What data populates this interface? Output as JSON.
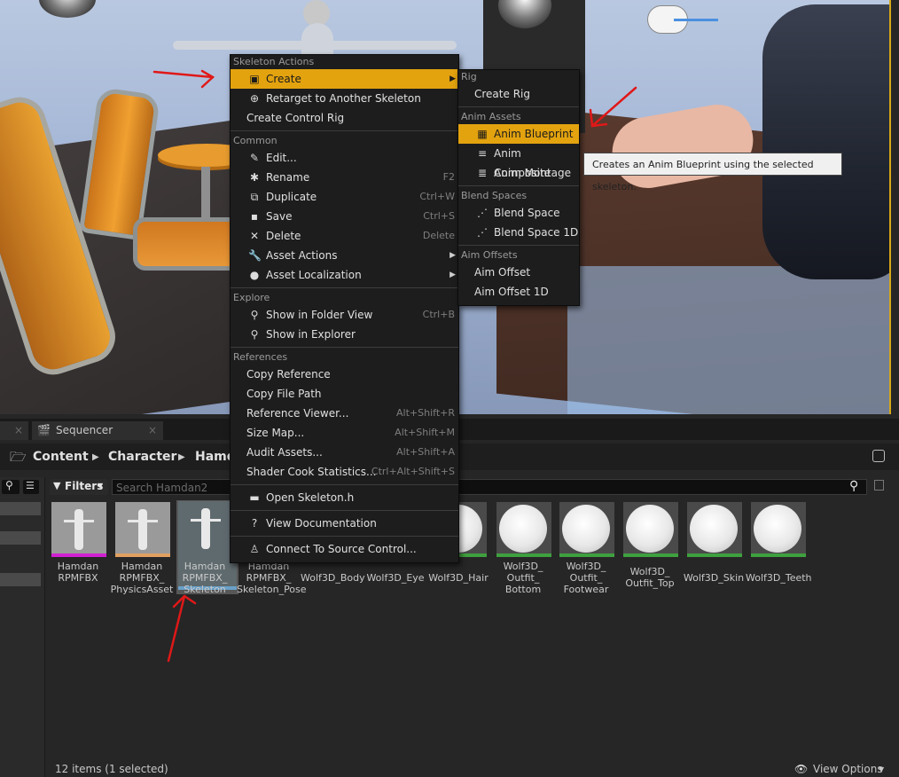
{
  "tabs": [
    {
      "label": "Sequencer",
      "close": "×"
    }
  ],
  "tab_close_left": "×",
  "breadcrumb": [
    "Content",
    "Character",
    "Hamdan2"
  ],
  "breadcrumb_visible": [
    "Content",
    "Character",
    "Hamd"
  ],
  "filters_label": "Filters",
  "search_placeholder": "Search Hamdan2",
  "assets": [
    {
      "label": "Hamdan RPMFBX",
      "lines": [
        "Hamdan",
        "RPMFBX"
      ],
      "bar_color": "#d020d0",
      "type": "mesh"
    },
    {
      "label": "Hamdan RPMFBX_PhysicsAsset",
      "lines": [
        "Hamdan",
        "RPMFBX_",
        "PhysicsAsset"
      ],
      "bar_color": "#e0a060",
      "type": "mesh"
    },
    {
      "label": "Hamdan RPMFBX_Skeleton",
      "lines": [
        "Hamdan",
        "RPMFBX_",
        "Skeleton"
      ],
      "bar_color": "#6aa0c8",
      "type": "skeleton"
    },
    {
      "label": "Hamdan RPMFBX_Skeleton_Pose",
      "lines": [
        "Hamdan",
        "RPMFBX_",
        "Skeleton_Pose"
      ],
      "bar_color": "#8a8a8a",
      "type": "hidden"
    },
    {
      "label": "Wolf3D_Body",
      "lines": [
        "Wolf3D_Body"
      ],
      "bar_color": "#3fa03f",
      "type": "sphere"
    },
    {
      "label": "Wolf3D_Eye",
      "lines": [
        "Wolf3D_Eye"
      ],
      "bar_color": "#3fa03f",
      "type": "sphere"
    },
    {
      "label": "Wolf3D_Hair",
      "lines": [
        "Wolf3D_Hair"
      ],
      "bar_color": "#3fa03f",
      "type": "sphere"
    },
    {
      "label": "Wolf3D_Outfit_Bottom",
      "lines": [
        "Wolf3D_",
        "Outfit_",
        "Bottom"
      ],
      "bar_color": "#3fa03f",
      "type": "sphere"
    },
    {
      "label": "Wolf3D_Outfit_Footwear",
      "lines": [
        "Wolf3D_",
        "Outfit_",
        "Footwear"
      ],
      "bar_color": "#3fa03f",
      "type": "sphere"
    },
    {
      "label": "Wolf3D_Outfit_Top",
      "lines": [
        "Wolf3D_",
        "Outfit_Top"
      ],
      "bar_color": "#3fa03f",
      "type": "sphere"
    },
    {
      "label": "Wolf3D_Skin",
      "lines": [
        "Wolf3D_Skin"
      ],
      "bar_color": "#3fa03f",
      "type": "sphere"
    },
    {
      "label": "Wolf3D_Teeth",
      "lines": [
        "Wolf3D_Teeth"
      ],
      "bar_color": "#3fa03f",
      "type": "sphere"
    }
  ],
  "status": "12 items (1 selected)",
  "view_options": "View Options",
  "context_menu": {
    "sections": [
      {
        "title": "Skeleton Actions",
        "items": [
          {
            "label": "Create",
            "icon": "create-icon",
            "submenu": true,
            "highlight": true
          },
          {
            "label": "Retarget to Another Skeleton",
            "icon": "retarget-icon"
          },
          {
            "label": "Create Control Rig",
            "icon": ""
          }
        ]
      },
      {
        "title": "Common",
        "items": [
          {
            "label": "Edit...",
            "icon": "edit-icon"
          },
          {
            "label": "Rename",
            "icon": "rename-icon",
            "shortcut": "F2"
          },
          {
            "label": "Duplicate",
            "icon": "duplicate-icon",
            "shortcut": "Ctrl+W"
          },
          {
            "label": "Save",
            "icon": "save-icon",
            "shortcut": "Ctrl+S"
          },
          {
            "label": "Delete",
            "icon": "delete-icon",
            "shortcut": "Delete"
          },
          {
            "label": "Asset Actions",
            "icon": "wrench-icon",
            "submenu": true
          },
          {
            "label": "Asset Localization",
            "icon": "globe-icon",
            "submenu": true
          }
        ]
      },
      {
        "title": "Explore",
        "items": [
          {
            "label": "Show in Folder View",
            "icon": "magnifier-icon",
            "shortcut": "Ctrl+B"
          },
          {
            "label": "Show in Explorer",
            "icon": "magnifier-icon"
          }
        ]
      },
      {
        "title": "References",
        "items": [
          {
            "label": "Copy Reference",
            "icon": ""
          },
          {
            "label": "Copy File Path",
            "icon": ""
          },
          {
            "label": "Reference Viewer...",
            "icon": "",
            "shortcut": "Alt+Shift+R"
          },
          {
            "label": "Size Map...",
            "icon": "",
            "shortcut": "Alt+Shift+M"
          },
          {
            "label": "Audit Assets...",
            "icon": "",
            "shortcut": "Alt+Shift+A"
          },
          {
            "label": "Shader Cook Statistics...",
            "icon": "",
            "shortcut": "Ctrl+Alt+Shift+S"
          }
        ]
      },
      {
        "title": "",
        "items": [
          {
            "label": "Open Skeleton.h",
            "icon": "header-file-icon"
          }
        ]
      },
      {
        "title": "",
        "items": [
          {
            "label": "View Documentation",
            "icon": "help-icon"
          }
        ]
      },
      {
        "title": "",
        "items": [
          {
            "label": "Connect To Source Control...",
            "icon": "source-control-icon"
          }
        ]
      }
    ]
  },
  "submenu": {
    "sections": [
      {
        "title": "Rig",
        "items": [
          {
            "label": "Create Rig",
            "icon": ""
          }
        ]
      },
      {
        "title": "Anim Assets",
        "items": [
          {
            "label": "Anim Blueprint",
            "icon": "anim-blueprint-icon",
            "highlight": true
          },
          {
            "label": "Anim Composite",
            "icon": "anim-composite-icon"
          },
          {
            "label": "Anim Montage",
            "icon": "anim-montage-icon"
          }
        ]
      },
      {
        "title": "Blend Spaces",
        "items": [
          {
            "label": "Blend Space",
            "icon": "blend-space-icon"
          },
          {
            "label": "Blend Space 1D",
            "icon": "blend-space-1d-icon"
          }
        ]
      },
      {
        "title": "Aim Offsets",
        "items": [
          {
            "label": "Aim Offset",
            "icon": ""
          },
          {
            "label": "Aim Offset 1D",
            "icon": ""
          }
        ]
      }
    ]
  },
  "tooltip": "Creates an Anim Blueprint using the selected skeleton.",
  "colors": {
    "highlight": "#e3a30f",
    "annotation_red": "#e01818",
    "viewport_border": "#d8a818"
  }
}
